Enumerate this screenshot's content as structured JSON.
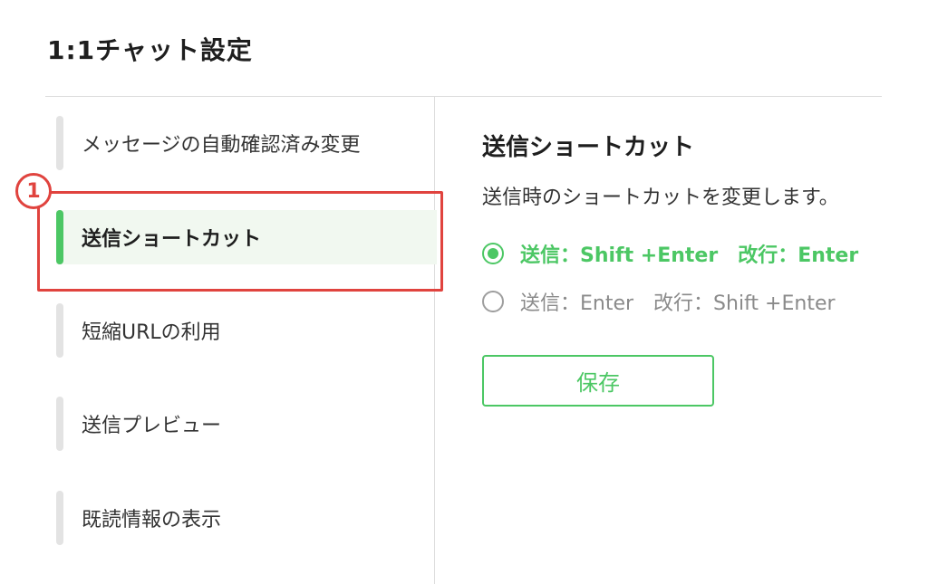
{
  "header": {
    "title": "1:1チャット設定"
  },
  "sidebar": {
    "items": [
      {
        "label": "メッセージの自動確認済み変更",
        "active": false
      },
      {
        "label": "送信ショートカット",
        "active": true
      },
      {
        "label": "短縮URLの利用",
        "active": false
      },
      {
        "label": "送信プレビュー",
        "active": false
      },
      {
        "label": "既読情報の表示",
        "active": false
      }
    ]
  },
  "annotation": {
    "step_number": "1"
  },
  "main": {
    "title": "送信ショートカット",
    "description": "送信時のショートカットを変更します。",
    "options": [
      {
        "label": "送信：Shift +Enter　改行：Enter",
        "selected": true
      },
      {
        "label": "送信：Enter　改行：Shift +Enter",
        "selected": false
      }
    ],
    "save_label": "保存"
  },
  "colors": {
    "accent": "#4cc764",
    "annotation": "#e0433e",
    "active_background": "#f1f8f0"
  }
}
